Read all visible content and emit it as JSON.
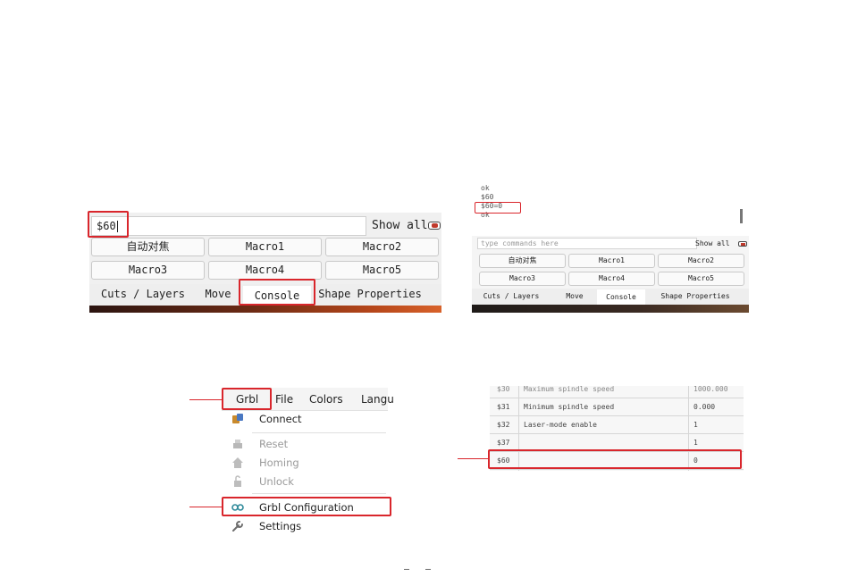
{
  "panel_a": {
    "command_value": "$60",
    "show_all": "Show all",
    "macros": [
      "自动对焦",
      "Macro1",
      "Macro2",
      "Macro3",
      "Macro4",
      "Macro5"
    ],
    "tabs": [
      "Cuts / Layers",
      "Move",
      "Console",
      "Shape Properties"
    ],
    "active_tab": "Console"
  },
  "panel_b": {
    "log_lines": [
      "ok",
      "$60",
      "$60=0",
      "ok"
    ],
    "command_placeholder": "type commands here",
    "show_all": "Show all",
    "macros": [
      "自动对焦",
      "Macro1",
      "Macro2",
      "Macro3",
      "Macro4",
      "Macro5"
    ],
    "tabs": [
      "Cuts / Layers",
      "Move",
      "Console",
      "Shape Properties"
    ]
  },
  "panel_c": {
    "menubar": [
      "Grbl",
      "File",
      "Colors",
      "Langu"
    ],
    "items": [
      {
        "label": "Connect",
        "icon": "connect-icon",
        "enabled": true
      },
      {
        "label": "Reset",
        "icon": "reset-icon",
        "enabled": false
      },
      {
        "label": "Homing",
        "icon": "homing-icon",
        "enabled": false
      },
      {
        "label": "Unlock",
        "icon": "unlock-icon",
        "enabled": false
      },
      {
        "label": "Grbl Configuration",
        "icon": "infinity-icon",
        "enabled": true
      },
      {
        "label": "Settings",
        "icon": "wrench-icon",
        "enabled": true
      }
    ]
  },
  "panel_d": {
    "rows": [
      {
        "code": "$30",
        "name": "Maximum spindle speed",
        "value": "1000.000"
      },
      {
        "code": "$31",
        "name": "Minimum spindle speed",
        "value": "0.000"
      },
      {
        "code": "$32",
        "name": "Laser-mode enable",
        "value": "1"
      },
      {
        "code": "$37",
        "name": "",
        "value": "1"
      },
      {
        "code": "$60",
        "name": "",
        "value": "0"
      }
    ]
  },
  "page_marker": "— —",
  "colors": {
    "highlight": "#d9262c",
    "toggle": "#c0392b",
    "gradient_start": "#2b1410",
    "gradient_end": "#d8622a"
  }
}
